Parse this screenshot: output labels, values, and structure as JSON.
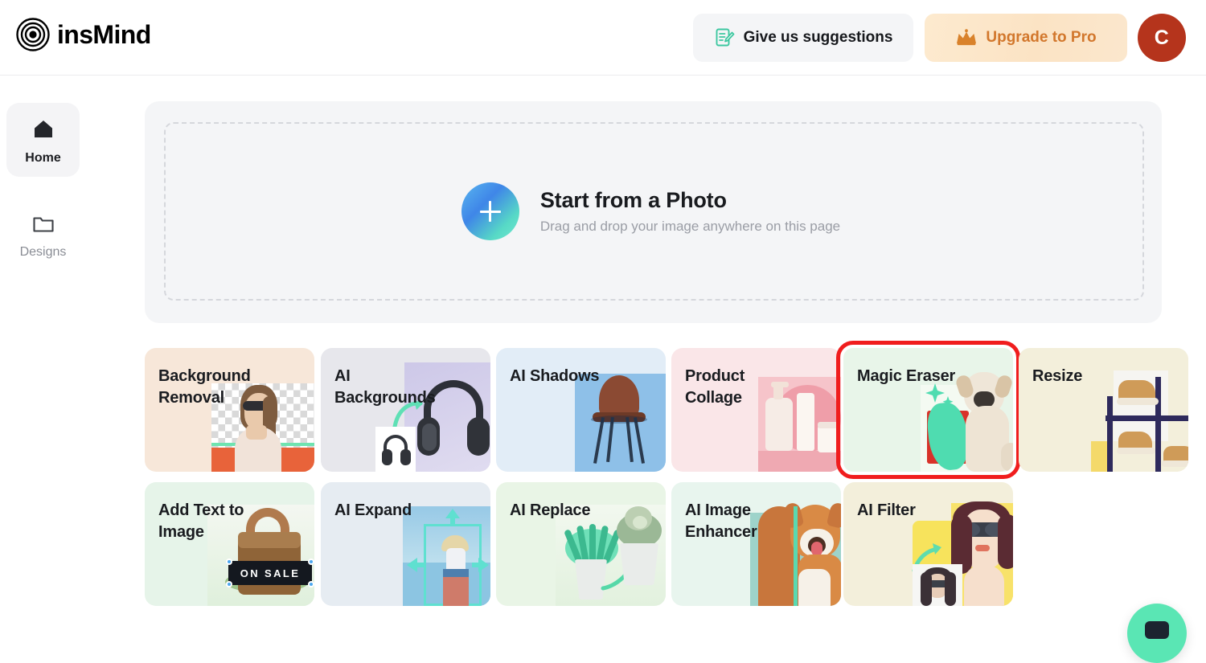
{
  "app": {
    "brand_name": "insMind",
    "logo_icon": "concentric-circles-logo"
  },
  "header": {
    "suggestions": {
      "label": "Give us suggestions",
      "icon": "edit-note-icon",
      "icon_color": "#3cc7a0"
    },
    "upgrade": {
      "label": "Upgrade to Pro",
      "icon": "crown-icon",
      "icon_color": "#d2772c",
      "text_color": "#d2772c",
      "bg_color": "#fbe5c8"
    },
    "avatar": {
      "initial": "C",
      "bg_color": "#b5341c"
    }
  },
  "sidebar": {
    "items": [
      {
        "label": "Home",
        "icon": "home-icon",
        "active": true
      },
      {
        "label": "Designs",
        "icon": "folder-icon",
        "active": false
      }
    ]
  },
  "dropzone": {
    "title": "Start from a Photo",
    "subtitle": "Drag and drop your image anywhere on this page",
    "button_icon": "plus-icon",
    "gradient_from": "#3f86e8",
    "gradient_to": "#72e8cf"
  },
  "tools": {
    "rows": [
      [
        {
          "title": "Background\nRemoval",
          "art": "woman-sunglasses-transparent",
          "bg_color": "#f7e7d9",
          "selected": false
        },
        {
          "title": "AI\nBackgrounds",
          "art": "headphones",
          "bg_color": "#e7e7ec",
          "selected": false
        },
        {
          "title": "AI Shadows",
          "art": "chair-shadow",
          "bg_color": "#e2edf7",
          "selected": false
        },
        {
          "title": "Product\nCollage",
          "art": "cosmetic-bottles",
          "bg_color": "#fae6e8",
          "selected": false
        },
        {
          "title": "Magic Eraser",
          "art": "dog-eraser-stroke",
          "bg_color": "#e8f5e9",
          "selected": true
        },
        {
          "title": "Resize",
          "art": "sneakers-grid",
          "bg_color": "#f3efdb",
          "selected": false
        }
      ],
      [
        {
          "title": "Add Text to\nImage",
          "art": "handbag-on-sale",
          "bg_color": "#e6f4e9",
          "selected": false
        },
        {
          "title": "AI Expand",
          "art": "beach-woman-expand",
          "bg_color": "#e6ecf2",
          "selected": false
        },
        {
          "title": "AI Replace",
          "art": "potted-plants",
          "bg_color": "#e9f5e6",
          "selected": false
        },
        {
          "title": "AI Image\nEnhancer",
          "art": "corgi-slider",
          "bg_color": "#e8f5ee",
          "selected": false
        },
        {
          "title": "AI Filter",
          "art": "illustrated-woman",
          "bg_color": "#f3efdb",
          "selected": false
        }
      ]
    ],
    "badge_on_sale": "ON SALE",
    "selection_color": "#f01d1d"
  },
  "chat": {
    "icon": "chat-bubble-icon",
    "bg_color": "#5ae6b4"
  }
}
